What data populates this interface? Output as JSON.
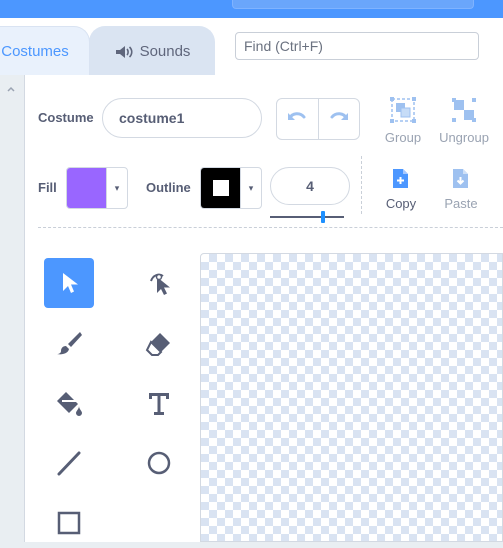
{
  "tabs": [
    {
      "label": "Costumes",
      "icon": "costume-icon"
    },
    {
      "label": "Sounds",
      "icon": "speaker-icon"
    }
  ],
  "find": {
    "placeholder": "Find (Ctrl+F)"
  },
  "costume": {
    "label": "Costume",
    "name": "costume1"
  },
  "toolbar": {
    "group": "Group",
    "ungroup": "Ungroup",
    "copy": "Copy",
    "paste": "Paste"
  },
  "fill": {
    "label": "Fill",
    "color": "#9966ff"
  },
  "outline": {
    "label": "Outline",
    "color": "#000000"
  },
  "size": {
    "value": "4",
    "slider_fraction": 0.4
  },
  "colors": {
    "accent": "#4c97ff",
    "text": "#575e75",
    "muted": "#9aa3b2"
  },
  "tools": [
    "select-tool",
    "reshape-tool",
    "brush-tool",
    "eraser-tool",
    "fill-tool",
    "text-tool",
    "line-tool",
    "circle-tool",
    "rectangle-tool"
  ]
}
